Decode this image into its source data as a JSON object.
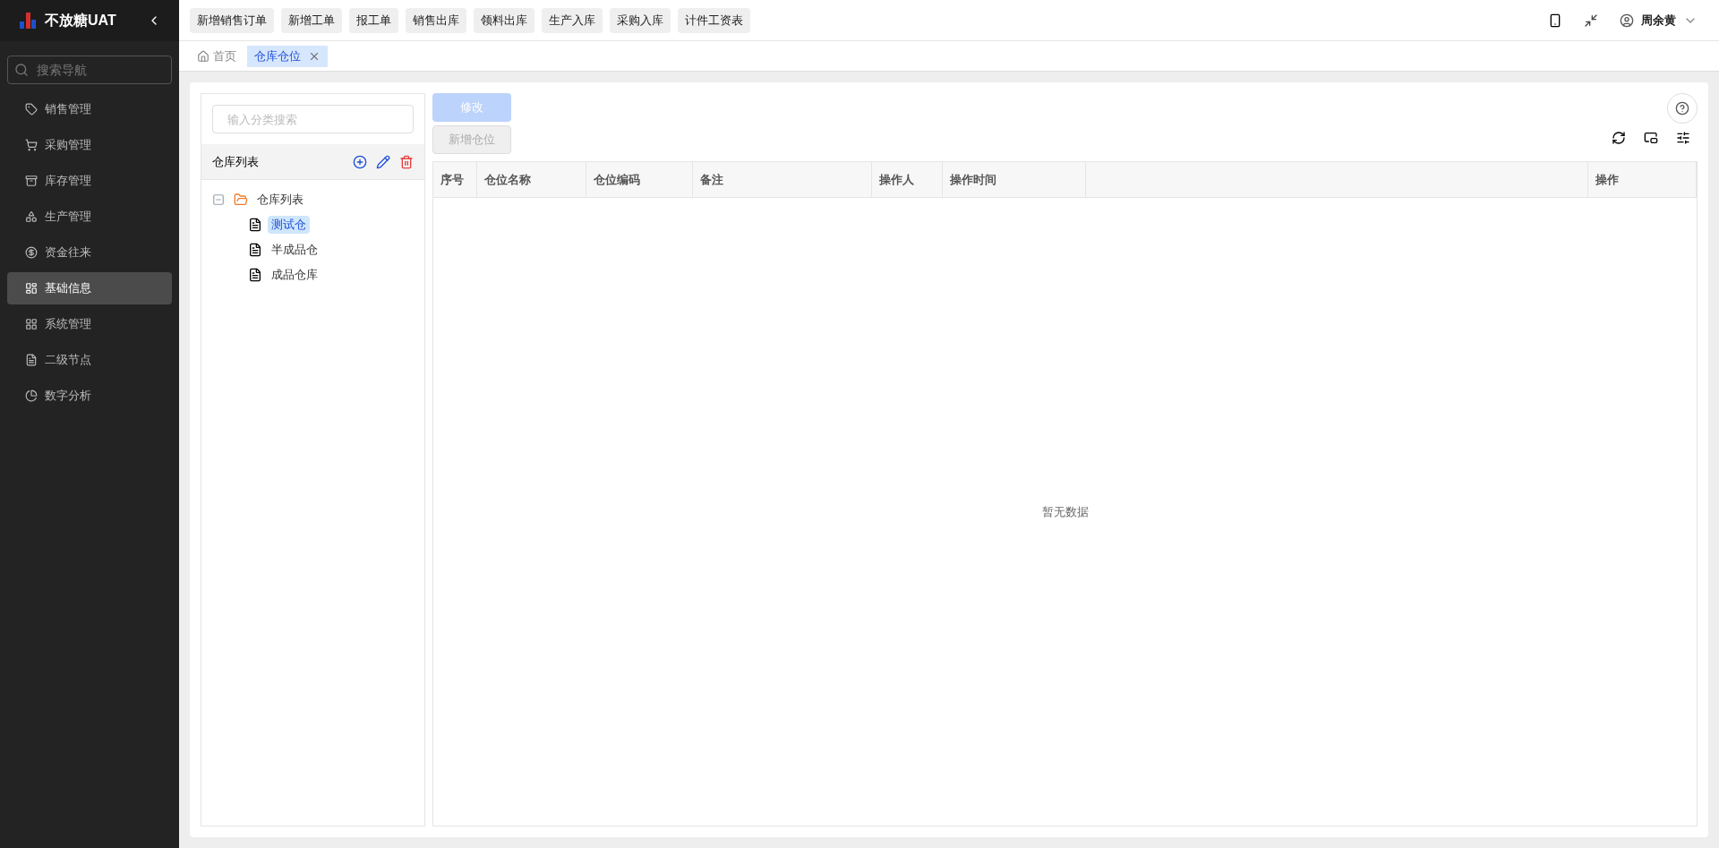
{
  "sidebar": {
    "logo_text": "不放糖UAT",
    "search": {
      "placeholder": "搜索导航"
    },
    "items": [
      {
        "label": "销售管理",
        "selected": false
      },
      {
        "label": "采购管理",
        "selected": false
      },
      {
        "label": "库存管理",
        "selected": false
      },
      {
        "label": "生产管理",
        "selected": false
      },
      {
        "label": "资金往来",
        "selected": false
      },
      {
        "label": "基础信息",
        "selected": true
      },
      {
        "label": "系统管理",
        "selected": false
      },
      {
        "label": "二级节点",
        "selected": false
      },
      {
        "label": "数字分析",
        "selected": false
      }
    ]
  },
  "quick_links": [
    "新增销售订单",
    "新增工单",
    "报工单",
    "销售出库",
    "领料出库",
    "生产入库",
    "采购入库",
    "计件工资表"
  ],
  "user": {
    "name": "周余黄"
  },
  "page_tabs": [
    {
      "label": "首页",
      "kind": "home",
      "selected": false
    },
    {
      "label": "仓库仓位",
      "kind": "closable",
      "selected": true
    }
  ],
  "tree_panel": {
    "search": {
      "placeholder": "输入分类搜索"
    },
    "title": "仓库列表",
    "tree": [
      {
        "label": "仓库列表",
        "expanded": true,
        "selected": false,
        "children": [
          {
            "label": "测试仓",
            "selected": true
          },
          {
            "label": "半成品仓",
            "selected": false
          },
          {
            "label": "成品仓库",
            "selected": false
          }
        ]
      }
    ]
  },
  "toolbar": {
    "buttons": [
      {
        "label": "修改",
        "kind": "primary",
        "disabled": true
      },
      {
        "label": "新增仓位",
        "kind": "default",
        "disabled": true
      }
    ]
  },
  "table": {
    "columns": [
      "序号",
      "仓位名称",
      "仓位编码",
      "备注",
      "操作人",
      "操作时间",
      "",
      "操作"
    ],
    "empty_text": "暂无数据"
  }
}
